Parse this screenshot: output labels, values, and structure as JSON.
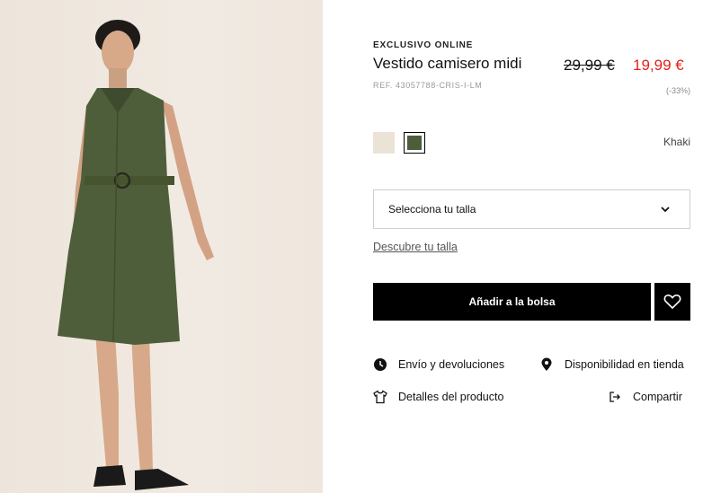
{
  "product": {
    "tag": "EXCLUSIVO ONLINE",
    "title": "Vestido camisero midi",
    "ref": "REF. 43057788-CRIS-I-LM",
    "old_price": "29,99 €",
    "new_price": "19,99 €",
    "discount": "(-33%)"
  },
  "colors": {
    "selected_name": "Khaki",
    "swatches": [
      {
        "name": "cream",
        "hex": "#ece3d7"
      },
      {
        "name": "khaki",
        "hex": "#4f5e3a"
      }
    ]
  },
  "size": {
    "select_label": "Selecciona tu talla",
    "guide_link": "Descubre tu talla"
  },
  "actions": {
    "add_to_bag": "Añadir a la bolsa",
    "wishlist_icon": "heart-icon"
  },
  "links": {
    "shipping": "Envío y devoluciones",
    "store_availability": "Disponibilidad en tienda",
    "details": "Detalles del producto",
    "share": "Compartir"
  },
  "colors_ui": {
    "price_red": "#e2231a",
    "dress_green": "#4f5e3a"
  }
}
